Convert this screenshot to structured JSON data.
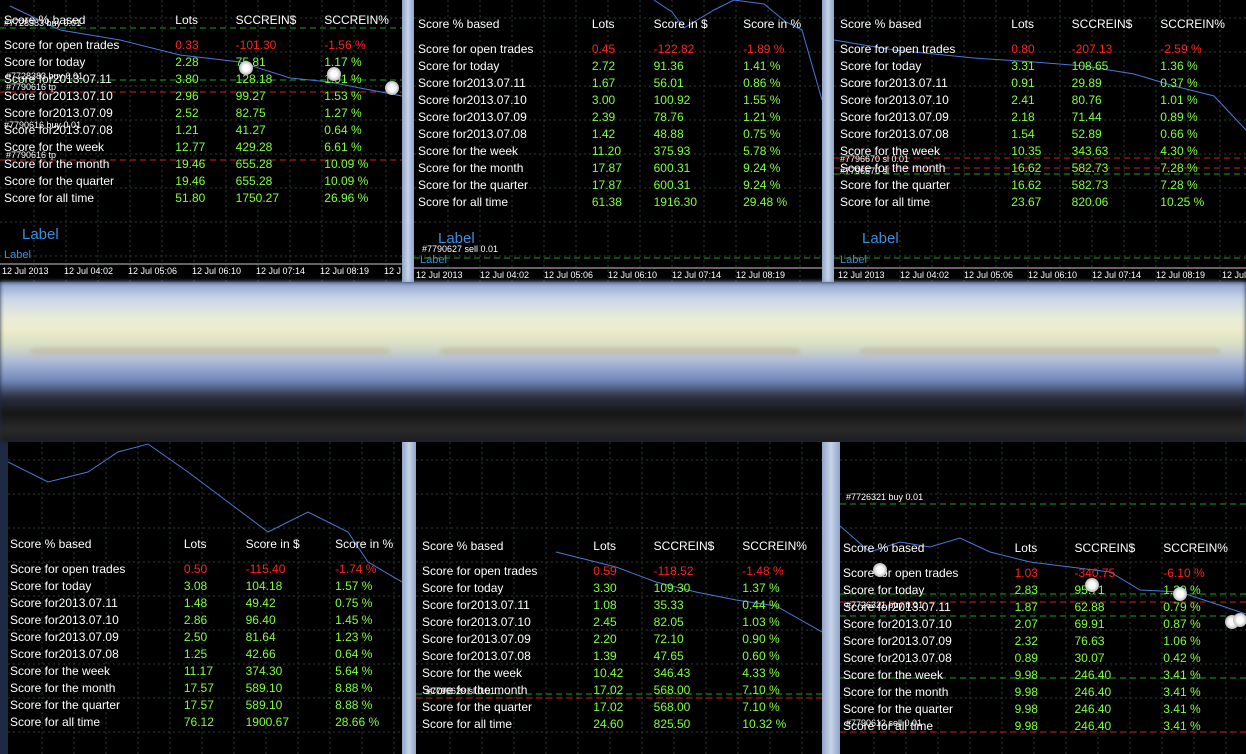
{
  "colors": {
    "background": "#000000",
    "positive": "#7fff3f",
    "negative": "#ff2020",
    "price_line": "#4a78d8",
    "grid": "#2c3e2c",
    "label": "#3a8fe0"
  },
  "row_labels": [
    "Score for open trades",
    "Score for today",
    "Score for2013.07.11",
    "Score for2013.07.10",
    "Score for2013.07.09",
    "Score for2013.07.08",
    "Score for the week",
    "Score for the month",
    "Score for the quarter",
    "Score for all time"
  ],
  "panels": [
    {
      "headers": [
        "Score % based",
        "Lots",
        "SCCREIN$",
        "SCCREIN%"
      ],
      "rows": [
        [
          "0.33",
          "-101.30",
          "-1.56 %"
        ],
        [
          "2.28",
          "75.81",
          "1.17 %"
        ],
        [
          "3.80",
          "128.18",
          "1.91 %"
        ],
        [
          "2.96",
          "99.27",
          "1.53 %"
        ],
        [
          "2.52",
          "82.75",
          "1.27 %"
        ],
        [
          "1.21",
          "41.27",
          "0.64 %"
        ],
        [
          "12.77",
          "429.28",
          "6.61 %"
        ],
        [
          "19.46",
          "655.28",
          "10.09 %"
        ],
        [
          "19.46",
          "655.28",
          "10.09 %"
        ],
        [
          "51.80",
          "1750.27",
          "26.96 %"
        ]
      ],
      "label_big": "Label",
      "label_small": "Label",
      "ticks": [
        "12 Jul 2013",
        "12 Jul 04:02",
        "12 Jul 05:06",
        "12 Jul 06:10",
        "12 Jul 07:14",
        "12 Jul 08:19",
        "12 J"
      ],
      "orders": [
        "#7728383 buy 0.01",
        "#7728383 buy 0.01",
        "#7790616 tp",
        "#7790616 buy 0.01",
        "#7790616 tp"
      ]
    },
    {
      "headers": [
        "Score % based",
        "Lots",
        "Score in $",
        "Score in %"
      ],
      "rows": [
        [
          "0.45",
          "-122.82",
          "-1.89 %"
        ],
        [
          "2.72",
          "91.36",
          "1.41 %"
        ],
        [
          "1.67",
          "56.01",
          "0.86 %"
        ],
        [
          "3.00",
          "100.92",
          "1.55 %"
        ],
        [
          "2.39",
          "78.76",
          "1.21 %"
        ],
        [
          "1.42",
          "48.88",
          "0.75 %"
        ],
        [
          "11.20",
          "375.93",
          "5.78 %"
        ],
        [
          "17.87",
          "600.31",
          "9.24 %"
        ],
        [
          "17.87",
          "600.31",
          "9.24 %"
        ],
        [
          "61.38",
          "1916.30",
          "29.48 %"
        ]
      ],
      "label_big": "Label",
      "label_small": "Label",
      "ticks": [
        "12 Jul 2013",
        "12 Jul 04:02",
        "12 Jul 05:06",
        "12 Jul 06:10",
        "12 Jul 07:14",
        "12 Jul 08:19"
      ],
      "orders": [
        "#7790627 sell 0.01"
      ]
    },
    {
      "headers": [
        "Score % based",
        "Lots",
        "SCCREIN$",
        "SCCREIN%"
      ],
      "rows": [
        [
          "0.80",
          "-207.13",
          "-2.59 %"
        ],
        [
          "3.31",
          "108.65",
          "1.36 %"
        ],
        [
          "0.91",
          "29.89",
          "0.37 %"
        ],
        [
          "2.41",
          "80.76",
          "1.01 %"
        ],
        [
          "2.18",
          "71.44",
          "0.89 %"
        ],
        [
          "1.54",
          "52.89",
          "0.66 %"
        ],
        [
          "10.35",
          "343.63",
          "4.30 %"
        ],
        [
          "16.62",
          "582.73",
          "7.28 %"
        ],
        [
          "16.62",
          "582.73",
          "7.28 %"
        ],
        [
          "23.67",
          "820.06",
          "10.25 %"
        ]
      ],
      "label_big": "Label",
      "label_small": "Label",
      "ticks": [
        "12 Jul 2013",
        "12 Jul 04:02",
        "12 Jul 05:06",
        "12 Jul 06:10",
        "12 Jul 07:14",
        "12 Jul 08:19",
        "12 Jul"
      ],
      "orders": [
        "#7796670 sl 0.01",
        "#7796670 sl"
      ]
    },
    {
      "headers": [
        "Score % based",
        "Lots",
        "Score in $",
        "Score in %"
      ],
      "rows": [
        [
          "0.50",
          "-115.40",
          "-1.74 %"
        ],
        [
          "3.08",
          "104.18",
          "1.57 %"
        ],
        [
          "1.48",
          "49.42",
          "0.75 %"
        ],
        [
          "2.86",
          "96.40",
          "1.45 %"
        ],
        [
          "2.50",
          "81.64",
          "1.23 %"
        ],
        [
          "1.25",
          "42.66",
          "0.64 %"
        ],
        [
          "11.17",
          "374.30",
          "5.64 %"
        ],
        [
          "17.57",
          "589.10",
          "8.88 %"
        ],
        [
          "17.57",
          "589.10",
          "8.88 %"
        ],
        [
          "76.12",
          "1900.67",
          "28.66 %"
        ]
      ],
      "orders": []
    },
    {
      "headers": [
        "Score % based",
        "Lots",
        "SCCREIN$",
        "SCCREIN%"
      ],
      "rows": [
        [
          "0.59",
          "-118.52",
          "-1.48 %"
        ],
        [
          "3.30",
          "109.30",
          "1.37 %"
        ],
        [
          "1.08",
          "35.33",
          "0.44 %"
        ],
        [
          "2.45",
          "82.05",
          "1.03 %"
        ],
        [
          "2.20",
          "72.10",
          "0.90 %"
        ],
        [
          "1.39",
          "47.65",
          "0.60 %"
        ],
        [
          "10.42",
          "346.43",
          "4.33 %"
        ],
        [
          "17.02",
          "568.00",
          "7.10 %"
        ],
        [
          "17.02",
          "568.00",
          "7.10 %"
        ],
        [
          "24.60",
          "825.50",
          "10.32 %"
        ]
      ],
      "orders": [
        "#7790629 sl 0.01"
      ]
    },
    {
      "headers": [
        "Score % based",
        "Lots",
        "SCCREIN$",
        "SCCREIN%"
      ],
      "rows": [
        [
          "1.03",
          "-340.75",
          "-6.10 %"
        ],
        [
          "2.83",
          "95.71",
          "1.20 %"
        ],
        [
          "1.87",
          "62.88",
          "0.79 %"
        ],
        [
          "2.07",
          "69.91",
          "0.87 %"
        ],
        [
          "2.32",
          "76.63",
          "1.06 %"
        ],
        [
          "0.89",
          "30.07",
          "0.42 %"
        ],
        [
          "9.98",
          "246.40",
          "3.41 %"
        ],
        [
          "9.98",
          "246.40",
          "3.41 %"
        ],
        [
          "9.98",
          "246.40",
          "3.41 %"
        ],
        [
          "9.98",
          "246.40",
          "3.41 %"
        ]
      ],
      "orders": [
        "#7726321 buy 0.01",
        "#7726321 buy 0.01",
        "#7790612 sell 0.01"
      ]
    }
  ]
}
